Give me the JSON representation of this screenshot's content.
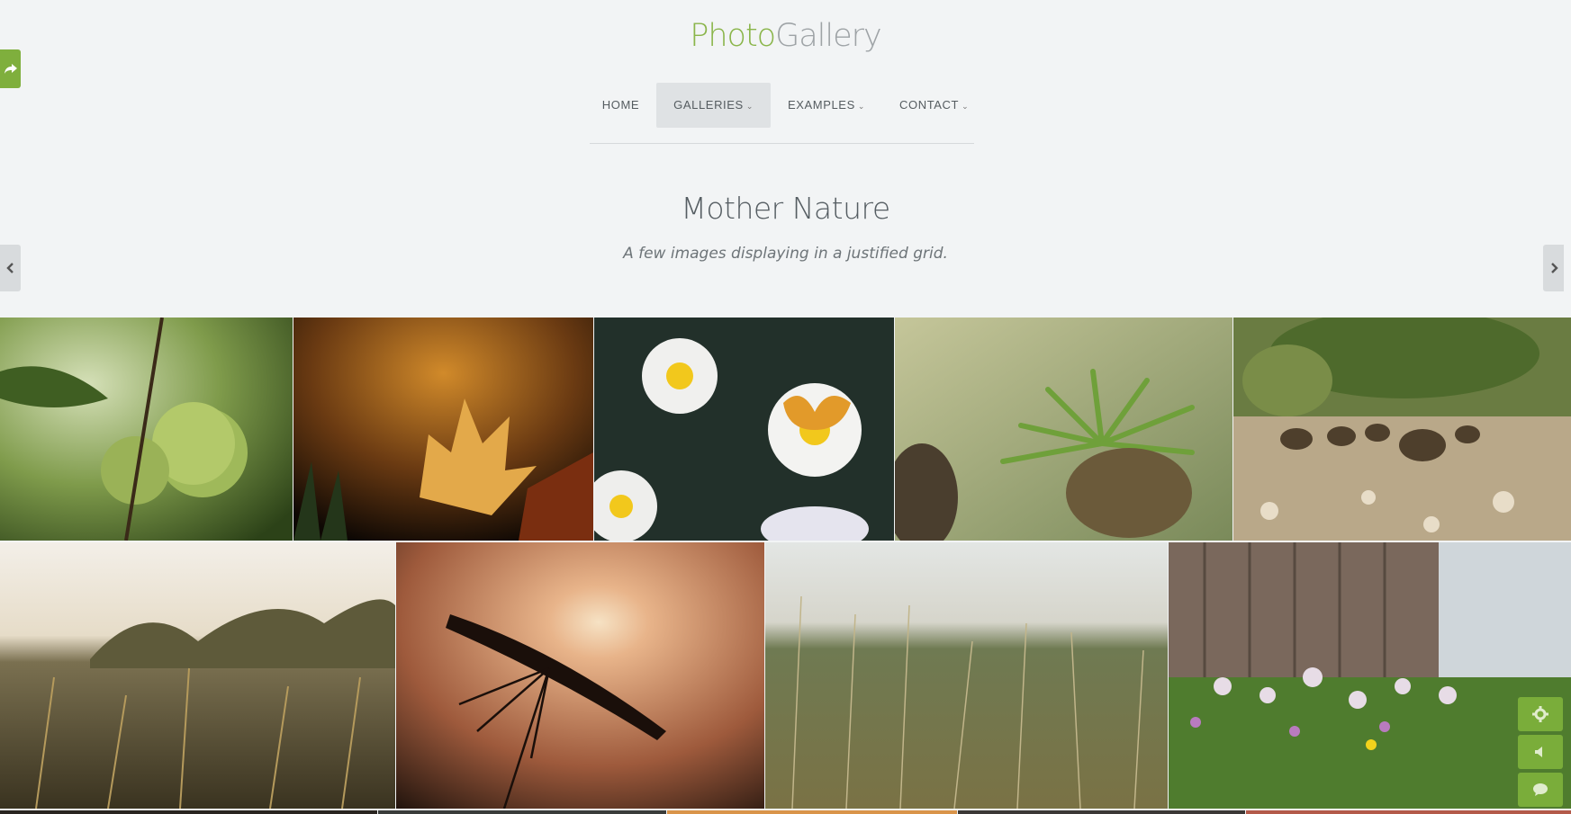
{
  "brand": {
    "part1": "Photo",
    "part2": "Gallery"
  },
  "nav": [
    {
      "label": "HOME",
      "has_caret": false,
      "active": false
    },
    {
      "label": "GALLERIES",
      "has_caret": true,
      "active": true
    },
    {
      "label": "EXAMPLES",
      "has_caret": true,
      "active": false
    },
    {
      "label": "CONTACT",
      "has_caret": true,
      "active": false
    }
  ],
  "page": {
    "title": "Mother Nature",
    "subtitle": "A few images displaying in a justified grid."
  },
  "icons": {
    "share": "share-icon",
    "prev": "chevron-left-icon",
    "next": "chevron-right-icon",
    "settings": "gear-icon",
    "volume": "speaker-icon",
    "chat": "chat-bubble-icon"
  },
  "gallery": [
    {
      "subject": "green apples",
      "colors": [
        "#c7d6a4",
        "#6d8e3c",
        "#2f4a1c"
      ]
    },
    {
      "subject": "autumn leaf",
      "colors": [
        "#c98422",
        "#6b3a10",
        "#140b05"
      ]
    },
    {
      "subject": "butterfly on daisy",
      "colors": [
        "#2f3a32",
        "#1a2a22",
        "#d9a53b"
      ]
    },
    {
      "subject": "pine branch",
      "colors": [
        "#c9c49a",
        "#74923f",
        "#3d4a2a"
      ]
    },
    {
      "subject": "pine cones on ground",
      "colors": [
        "#5d6a3a",
        "#8b7a5e",
        "#c7b49b"
      ]
    },
    {
      "subject": "sunlit field",
      "colors": [
        "#eeeae2",
        "#8c7a52",
        "#3b3420"
      ]
    },
    {
      "subject": "flower silhouette at sunset",
      "colors": [
        "#e8c3a0",
        "#c0704a",
        "#2a1710"
      ]
    },
    {
      "subject": "tall grass",
      "colors": [
        "#dfe2df",
        "#9e9a6e",
        "#5f5a38"
      ]
    },
    {
      "subject": "pink flowers by wooden wall",
      "colors": [
        "#d8dde0",
        "#7a6a5e",
        "#4a7a30"
      ]
    }
  ]
}
